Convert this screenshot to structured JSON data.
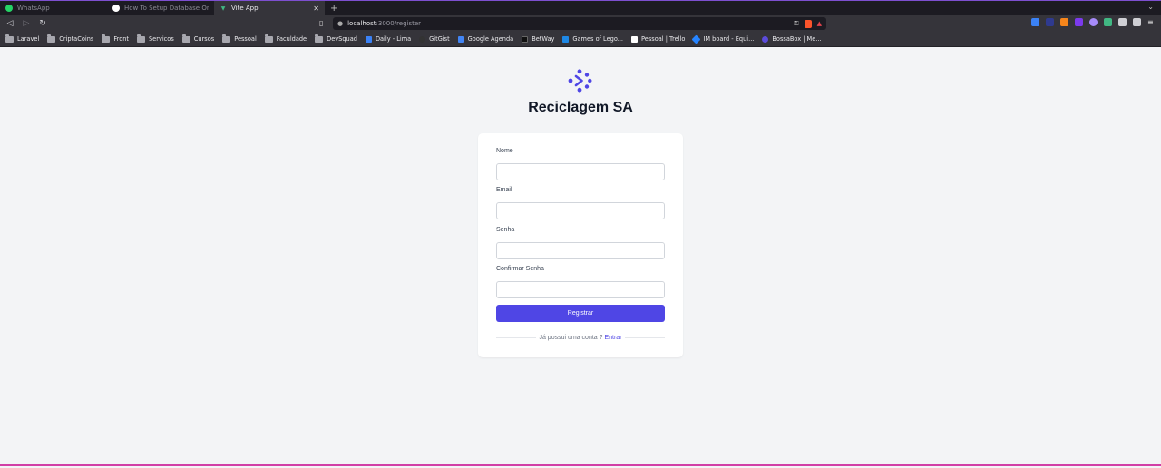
{
  "browser": {
    "tabs": [
      {
        "title": "WhatsApp",
        "color": "#25d366"
      },
      {
        "title": "How To Setup Database On Ro",
        "color": "#ffffff"
      },
      {
        "title": "Vite App",
        "color": "#41b883"
      }
    ],
    "new_tab": "+",
    "url_host": "localhost",
    "url_path": ":3000/register",
    "bookmarks": [
      {
        "label": "Laravel",
        "type": "folder"
      },
      {
        "label": "CriptaCoins",
        "type": "folder"
      },
      {
        "label": "Front",
        "type": "folder"
      },
      {
        "label": "Servicos",
        "type": "folder"
      },
      {
        "label": "Cursos",
        "type": "folder"
      },
      {
        "label": "Pessoal",
        "type": "folder"
      },
      {
        "label": "Faculdade",
        "type": "folder"
      },
      {
        "label": "DevSquad",
        "type": "folder"
      },
      {
        "label": "Daily - Lima",
        "type": "site",
        "color": "#3b82f6"
      },
      {
        "label": "GitGist",
        "type": "site",
        "color": "#333333"
      },
      {
        "label": "Google Agenda",
        "type": "site",
        "color": "#4285f4"
      },
      {
        "label": "BetWay",
        "type": "site",
        "color": "#111111"
      },
      {
        "label": "Games of Lego...",
        "type": "site",
        "color": "#1e88e5"
      },
      {
        "label": "Pessoal | Trello",
        "type": "site",
        "color": "#ffffff"
      },
      {
        "label": "IM board - Equi...",
        "type": "site",
        "color": "#2684ff"
      },
      {
        "label": "BossaBox | Me...",
        "type": "site",
        "color": "#5b4bdb"
      }
    ]
  },
  "app": {
    "brand": "Reciclagem SA",
    "accent": "#4f46e5",
    "fields": {
      "name_label": "Nome",
      "email_label": "Email",
      "password_label": "Senha",
      "confirm_label": "Confirmar Senha"
    },
    "submit_label": "Registrar",
    "login_prompt": "Já possui uma conta ?",
    "login_link": "Entrar"
  }
}
